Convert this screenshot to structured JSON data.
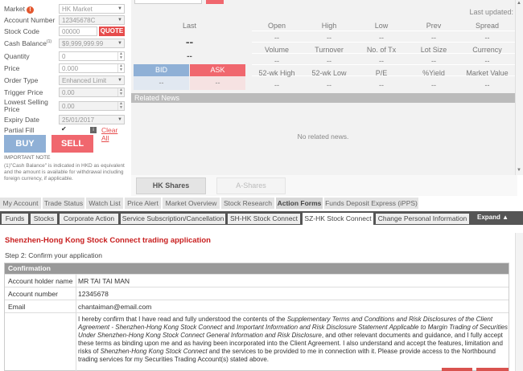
{
  "order": {
    "market_label": "Market",
    "market_value": "HK Market",
    "account_label": "Account Number",
    "account_value": "12345678C",
    "stock_code_label": "Stock Code",
    "stock_code_value": "00000",
    "quote_label": "QUOTE",
    "cash_balance_label": "Cash Balance",
    "cash_balance_sup": "(1)",
    "cash_balance_value": "$9,999,999.99",
    "quantity_label": "Quantity",
    "quantity_value": "0",
    "price_label": "Price",
    "price_value": "0.000",
    "order_type_label": "Order Type",
    "order_type_value": "Enhanced Limit",
    "trigger_price_label": "Trigger Price",
    "trigger_price_value": "0.00",
    "lowest_selling_label_1": "Lowest Selling",
    "lowest_selling_label_2": "Price",
    "lowest_selling_value": "0.00",
    "expiry_label": "Expiry Date",
    "expiry_value": "25/01/2017",
    "partial_fill_label": "Partial Fill",
    "clear_all_label": "Clear All",
    "buy_label": "BUY",
    "sell_label": "SELL",
    "important_note": "IMPORTANT NOTE",
    "cash_note": "(1)\"Cash Balance\" is indicated in HKD as equivalent and the amount is available for withdrawal including foreign currency, if applicable."
  },
  "quote": {
    "last_updated_label": "Last updated:",
    "last_header": "Last",
    "last_value": "--",
    "last_sub_value": "--",
    "row1_headers": [
      "Open",
      "High",
      "Low",
      "Prev",
      "Spread"
    ],
    "row1_values": [
      "--",
      "--",
      "--",
      "--",
      "--"
    ],
    "row2_headers": [
      "Volume",
      "Turnover",
      "No. of Tx",
      "Lot Size",
      "Currency"
    ],
    "row2_values": [
      "--",
      "--",
      "--",
      "--",
      "--"
    ],
    "row3_headers": [
      "52-wk High",
      "52-wk Low",
      "P/E",
      "%Yield",
      "Market Value"
    ],
    "row3_values": [
      "--",
      "--",
      "--",
      "--",
      "--"
    ],
    "bid_label": "BID",
    "ask_label": "ASK",
    "bid_value": "--",
    "ask_value": "--",
    "related_news_label": "Related News",
    "no_news_label": "No related news."
  },
  "market_tabs": {
    "hk_shares": "HK Shares",
    "a_shares": "A-Shares"
  },
  "main_nav": [
    "My Account",
    "Trade Status",
    "Watch List",
    "Price Alert",
    "Market Overview",
    "Stock Research",
    "Action Forms",
    "Funds Deposit Express (iPPS)"
  ],
  "sub_nav": [
    "Funds",
    "Stocks",
    "Corporate Action",
    "Service Subscription/Cancellation",
    "SH-HK Stock Connect",
    "SZ-HK Stock Connect",
    "Change Personal Information"
  ],
  "expand_label": "Expand",
  "application": {
    "title": "Shenzhen-Hong Kong Stock Connect trading application",
    "step": "Step 2: Confirm your application",
    "confirmation_header": "Confirmation",
    "holder_label": "Account holder name",
    "holder_value": "MR TAI TAI MAN",
    "account_label": "Account number",
    "account_value": "12345678",
    "email_label": "Email",
    "email_value": "chantaiman@email.com",
    "declaration": {
      "p1": "I hereby confirm that I have read and fully understood the contents of the ",
      "i1": "Supplementary Terms and Conditions and Risk Disclosures of the Client Agreement - Shenzhen-Hong Kong Stock Connect",
      "p2": " and ",
      "i2": "Important Information and Risk Disclosure Statement Applicable to Margin Trading of Securities Under Shenzhen-Hong Kong Stock Connect General Information and Risk Disclosure",
      "p3": ", and other relevant documents and guidance, and I fully accept these terms as binding upon me and as having been incorporated into the Client Agreement. I also understand and accept the features, limitation and risks of ",
      "i3": "Shenzhen-Hong Kong Stock Connect",
      "p4": " and the services to be provided to me in connection with it. Please provide access to the Northbound trading services for my Securities Trading Account(s) stated above."
    }
  },
  "colors": {
    "buy": "#8fb0d6",
    "sell": "#f0676e",
    "title_red": "#c81e1e"
  }
}
